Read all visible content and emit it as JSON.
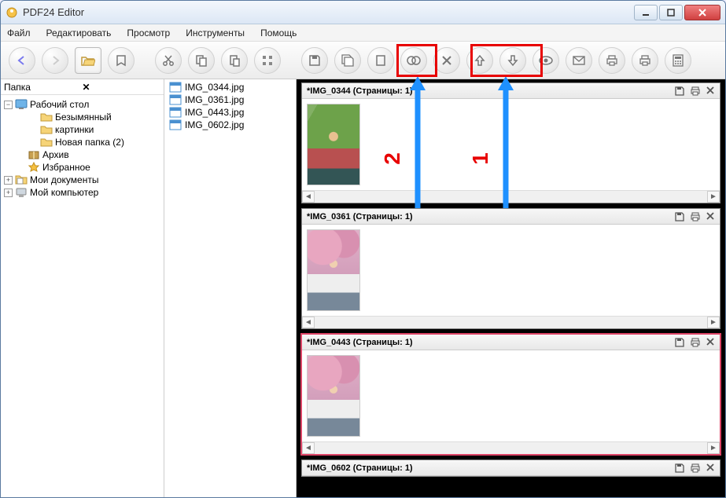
{
  "window": {
    "title": "PDF24 Editor"
  },
  "menu": {
    "file": "Файл",
    "edit": "Редактировать",
    "view": "Просмотр",
    "tools": "Инструменты",
    "help": "Помощь"
  },
  "tree": {
    "header": "Папка",
    "root": "Рабочий стол",
    "items": [
      "Безымянный",
      "картинки",
      "Новая папка (2)"
    ],
    "archive": "Архив",
    "favorites": "Избранное",
    "docs": "Мои документы",
    "computer": "Мой компьютер"
  },
  "files": [
    "IMG_0344.jpg",
    "IMG_0361.jpg",
    "IMG_0443.jpg",
    "IMG_0602.jpg"
  ],
  "docs": [
    {
      "title": "*IMG_0344 (Страницы: 1)"
    },
    {
      "title": "*IMG_0361 (Страницы: 1)"
    },
    {
      "title": "*IMG_0443 (Страницы: 1)"
    },
    {
      "title": "*IMG_0602 (Страницы: 1)"
    }
  ],
  "annotations": {
    "label1": "1",
    "label2": "2"
  }
}
